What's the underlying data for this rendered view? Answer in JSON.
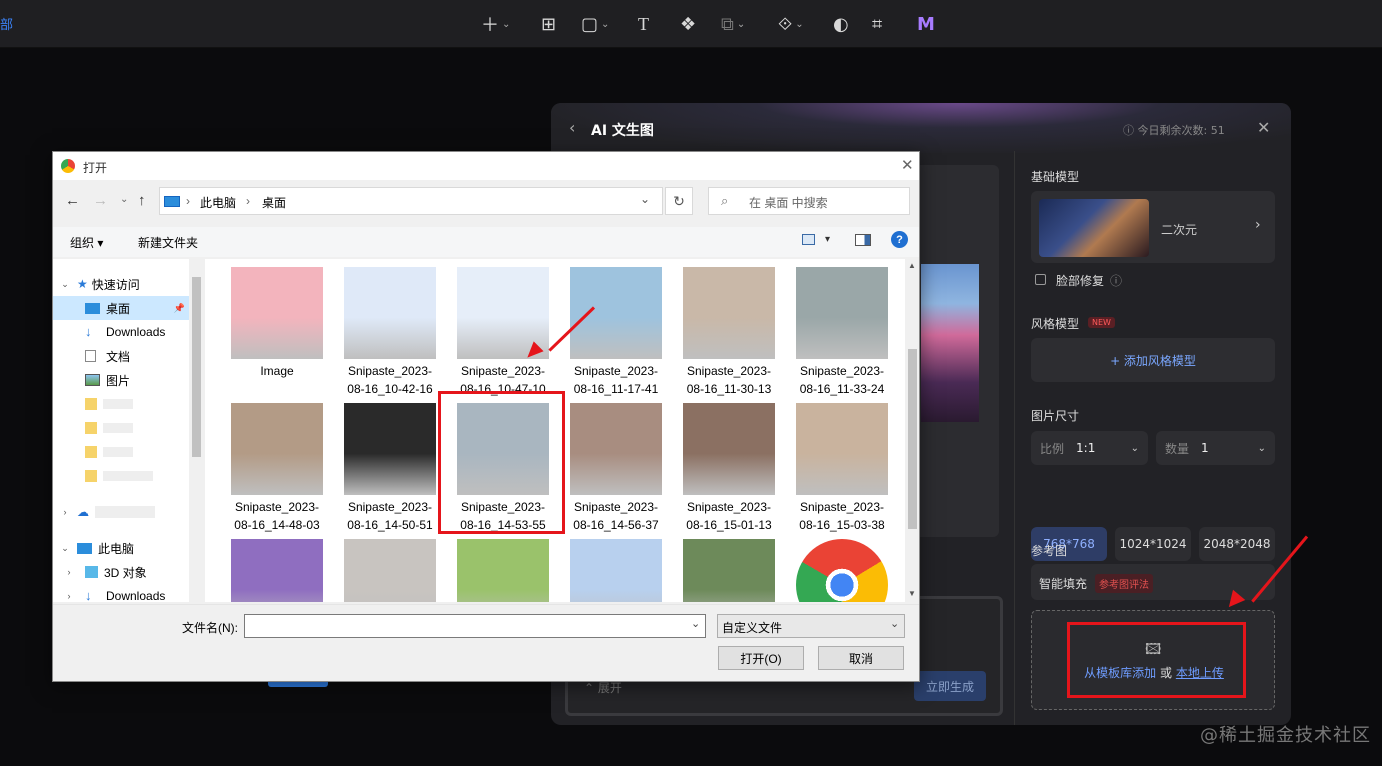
{
  "edge_text": "部",
  "toolbar": {
    "icons": [
      "plus-icon",
      "frame-icon",
      "rectangle-icon",
      "text-icon",
      "component-icon",
      "boolean-icon",
      "vector-icon",
      "circle-icon",
      "crop-icon",
      "ai-logo-icon"
    ]
  },
  "ai_panel": {
    "title": "AI 文生图",
    "remaining": "今日剩余次数: 51",
    "base_model_label": "基础模型",
    "base_model_name": "二次元",
    "face_fix_label": "脸部修复",
    "style_model_label": "风格模型",
    "new_badge": "NEW",
    "add_style": "+ 添加风格模型",
    "image_size_label": "图片尺寸",
    "ratio_label": "比例",
    "ratio_value": "1:1",
    "count_label": "数量",
    "count_value": "1",
    "sizes": [
      "768*768",
      "1024*1024",
      "2048*2048"
    ],
    "reference_label": "参考图",
    "smart_fill": "智能填充",
    "ref_badge": "参考图评法",
    "upload_from_lib": "从模板库添加",
    "upload_or": "或",
    "upload_local": "本地上传",
    "expand": "展开",
    "generate": "立即生成"
  },
  "dialog": {
    "title": "打开",
    "path": [
      "此电脑",
      "桌面"
    ],
    "search_placeholder": "在 桌面 中搜索",
    "organize": "组织 ▾",
    "new_folder": "新建文件夹",
    "nav": {
      "quick_access": "快速访问",
      "items": [
        "桌面",
        "Downloads",
        "文档",
        "图片"
      ],
      "this_pc": "此电脑",
      "pc_items": [
        "3D 对象",
        "Downloads"
      ]
    },
    "files": [
      {
        "l1": "Image",
        "l2": "",
        "c": "#f3b4bd"
      },
      {
        "l1": "Snipaste_2023-",
        "l2": "08-16_10-42-16",
        "c": "#dfe9f8"
      },
      {
        "l1": "Snipaste_2023-",
        "l2": "08-16_10-47-10",
        "c": "#e6eef9"
      },
      {
        "l1": "Snipaste_2023-",
        "l2": "08-16_11-17-41",
        "c": "#9ec3de"
      },
      {
        "l1": "Snipaste_2023-",
        "l2": "08-16_11-30-13",
        "c": "#c9b8a8"
      },
      {
        "l1": "Snipaste_2023-",
        "l2": "08-16_11-33-24",
        "c": "#9aa7a8"
      },
      {
        "l1": "Snipaste_2023-",
        "l2": "08-16_14-48-03",
        "c": "#b39b86"
      },
      {
        "l1": "Snipaste_2023-",
        "l2": "08-16_14-50-51",
        "c": "#2a2a2a"
      },
      {
        "l1": "Snipaste_2023-",
        "l2": "08-16_14-53-55",
        "c": "#a9b6c0"
      },
      {
        "l1": "Snipaste_2023-",
        "l2": "08-16_14-56-37",
        "c": "#a88d80"
      },
      {
        "l1": "Snipaste_2023-",
        "l2": "08-16_15-01-13",
        "c": "#8b7062"
      },
      {
        "l1": "Snipaste_2023-",
        "l2": "08-16_15-03-38",
        "c": "#c9b39e"
      },
      {
        "l1": "",
        "l2": "",
        "c": "#8f6ec0"
      },
      {
        "l1": "",
        "l2": "",
        "c": "#c8c4c0"
      },
      {
        "l1": "",
        "l2": "",
        "c": "#9ac26b"
      },
      {
        "l1": "",
        "l2": "",
        "c": "#b8d0ee"
      },
      {
        "l1": "",
        "l2": "",
        "c": "#6d8a5a"
      },
      {
        "l1": "",
        "l2": "",
        "c": "#ffffff"
      }
    ],
    "filename_label": "文件名(N):",
    "filename_value": "",
    "filter": "自定义文件",
    "open_btn": "打开(O)",
    "cancel_btn": "取消"
  },
  "watermark": "@稀土掘金技术社区"
}
